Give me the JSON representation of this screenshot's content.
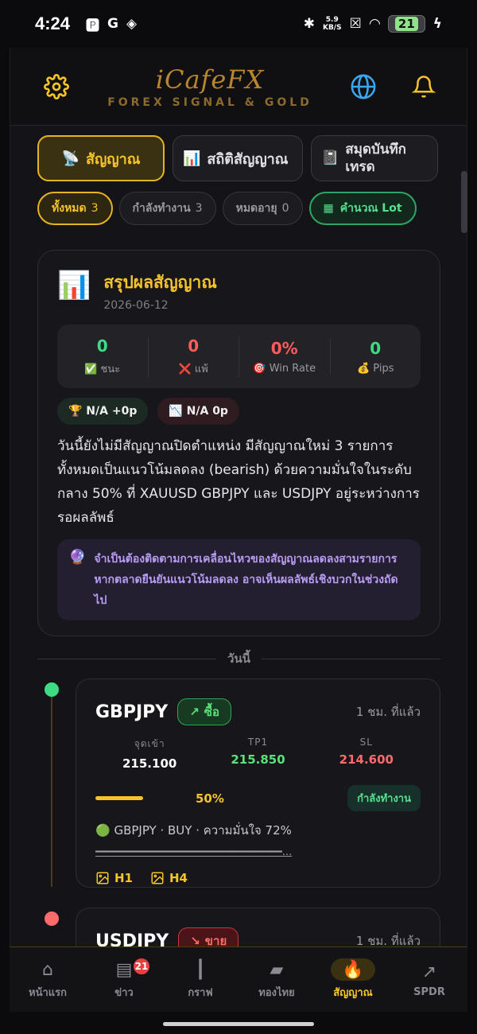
{
  "status_bar": {
    "time": "4:24",
    "net_speed": "5.9",
    "net_unit": "KB/S",
    "battery": "21"
  },
  "header": {
    "brand": "iCafeFX",
    "tagline": "FOREX SIGNAL & GOLD"
  },
  "tabs": [
    {
      "icon": "📡",
      "label": "สัญญาณ"
    },
    {
      "icon": "📊",
      "label": "สถิติสัญญาณ"
    },
    {
      "icon": "📓",
      "label": "สมุดบันทึกเทรด"
    }
  ],
  "filters": {
    "all_label": "ทั้งหมด",
    "all_count": "3",
    "active_label": "กำลังทำงาน",
    "active_count": "3",
    "expired_label": "หมดอายุ",
    "expired_count": "0",
    "calc_label": "คำนวณ Lot"
  },
  "summary": {
    "icon": "📊",
    "title": "สรุปผลสัญญาณ",
    "date": "2026-06-12",
    "stats": [
      {
        "value": "0",
        "label": "✅ ชนะ",
        "color": "#3ddc84"
      },
      {
        "value": "0",
        "label": "❌ แพ้",
        "color": "#ff5c5c"
      },
      {
        "value": "0%",
        "label": "🎯 Win Rate",
        "color": "#ff5c5c"
      },
      {
        "value": "0",
        "label": "💰 Pips",
        "color": "#3ddc84"
      }
    ],
    "best": "🏆 N/A +0p",
    "worst": "📉 N/A 0p",
    "text": "วันนี้ยังไม่มีสัญญาณปิดตำแหน่ง มีสัญญาณใหม่ 3 รายการทั้งหมดเป็นแนวโน้มลดลง (bearish) ด้วยความมั่นใจในระดับกลาง 50% ที่ XAUUSD GBPJPY และ USDJPY อยู่ระหว่างการรอผลลัพธ์",
    "note_icon": "🔮",
    "note": "จำเป็นต้องติดตามการเคลื่อนไหวของสัญญาณลดลงสามรายการ หากตลาดยืนยันแนวโน้มลดลง อาจเห็นผลลัพธ์เชิงบวกในช่วงถัดไป"
  },
  "divider_label": "วันนี้",
  "signals": [
    {
      "symbol": "GBPJPY",
      "side": "ซื้อ",
      "side_icon": "↗",
      "time": "1 ชม. ที่แล้ว",
      "entry_label": "จุดเข้า",
      "entry": "215.100",
      "tp_label": "TP1",
      "tp": "215.850",
      "sl_label": "SL",
      "sl": "214.600",
      "progress": "50%",
      "status": "กำลังทำงาน",
      "desc": "🟢 GBPJPY · BUY · ความมั่นใจ 72%",
      "desc2": "━━━━━━━━━━━━━━━━━━━━━━━━━━━━━━...",
      "tf1": "H1",
      "tf2": "H4"
    },
    {
      "symbol": "USDJPY",
      "side": "ขาย",
      "side_icon": "↘",
      "time": "1 ชม. ที่แล้ว"
    }
  ],
  "nav": [
    {
      "icon": "⌂",
      "label": "หน้าแรก"
    },
    {
      "icon": "▤",
      "label": "ข่าว",
      "badge": "21"
    },
    {
      "icon": "┃",
      "label": "กราฟ"
    },
    {
      "icon": "▰",
      "label": "ทองไทย"
    },
    {
      "icon": "🔥",
      "label": "สัญญาณ"
    },
    {
      "icon": "↗",
      "label": "SPDR"
    }
  ],
  "colors": {
    "accent": "#f6c42a",
    "buy": "#5be07a",
    "sell": "#ff6a6a",
    "background": "#0b0b0e"
  }
}
